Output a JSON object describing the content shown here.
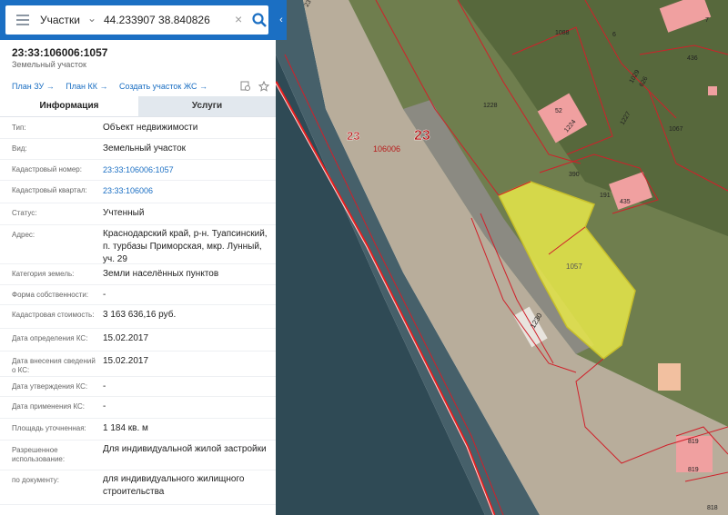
{
  "search": {
    "type_label": "Участки",
    "coordinates": "44.233907 38.840826"
  },
  "object": {
    "number": "23:33:106006:1057",
    "type": "Земельный участок"
  },
  "links": {
    "plan_zu": "План ЗУ →",
    "plan_kk": "План КК →",
    "create_zs": "Создать участок ЖС →"
  },
  "tabs": {
    "info": "Информация",
    "services": "Услуги"
  },
  "fields": [
    {
      "key": "Тип:",
      "value": "Объект недвижимости"
    },
    {
      "key": "Вид:",
      "value": "Земельный участок"
    },
    {
      "key": "Кадастровый номер:",
      "value": "23:33:106006:1057"
    },
    {
      "key": "Кадастровый квартал:",
      "value": "23:33:106006"
    },
    {
      "key": "Статус:",
      "value": "Учтенный"
    },
    {
      "key": "Адрес:",
      "value": "Краснодарский край, р-н. Туапсинский, п. турбазы Приморская, мкр. Лунный, уч. 29"
    },
    {
      "key": "Категория земель:",
      "value": "Земли населённых пунктов"
    },
    {
      "key": "Форма собственности:",
      "value": "-"
    },
    {
      "key": "Кадастровая стоимость:",
      "value": "3 163 636,16 руб."
    },
    {
      "key": "Дата определения КС:",
      "value": "15.02.2017"
    },
    {
      "key": "Дата внесения сведений о КС:",
      "value": "15.02.2017"
    },
    {
      "key": "Дата утверждения КС:",
      "value": "-"
    },
    {
      "key": "Дата применения КС:",
      "value": "-"
    },
    {
      "key": "Площадь уточненная:",
      "value": "1 184 кв. м"
    },
    {
      "key": "Разрешенное использование:",
      "value": "Для индивидуальной жилой застройки"
    },
    {
      "key": "по документу:",
      "value": "для индивидуального жилищного строительства"
    }
  ],
  "map": {
    "zone_left": "23",
    "zone_right": "23",
    "quarter": "106006",
    "parcels": {
      "p1057": "1057",
      "p1230": "1230",
      "p1228": "1228",
      "p1088": "1088",
      "p6": "6",
      "p7": "7",
      "p436": "436",
      "p52": "52",
      "p1224": "1224",
      "p1227": "1227",
      "p1029": "1029",
      "p626": "626",
      "p1067": "1067",
      "p390": "390",
      "p191": "191",
      "p435": "435",
      "p819a": "819",
      "p819b": "819",
      "p818": "818",
      "p23": "23"
    }
  },
  "colors": {
    "header": "#1b6fc3",
    "link": "#1b6fc3",
    "selected_parcel": "#e8e84a",
    "boundary": "#d0202a"
  }
}
